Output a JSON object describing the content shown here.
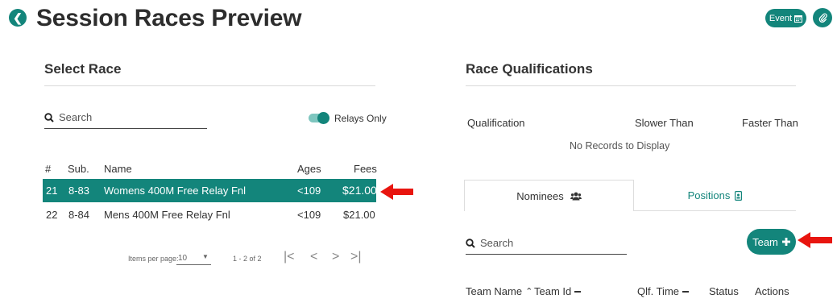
{
  "header": {
    "back_icon": "arrow-left-icon",
    "title": "Session Races Preview",
    "event_label": "Event",
    "event_icon": "calendar-icon",
    "attach_icon": "paperclip-icon",
    "accent_color": "#13857b",
    "pointer_color": "#e8150f"
  },
  "select_race": {
    "title": "Select Race",
    "search_placeholder": "Search",
    "relays_only_label": "Relays Only",
    "relays_only_on": true,
    "columns": [
      "#",
      "Sub.",
      "Name",
      "Ages",
      "Fees"
    ],
    "rows": [
      {
        "num": "21",
        "sub": "8-83",
        "name": "Womens 400M Free Relay Fnl",
        "ages": "<109",
        "fees": "$21.00",
        "selected": true
      },
      {
        "num": "22",
        "sub": "8-84",
        "name": "Mens 400M Free Relay Fnl",
        "ages": "<109",
        "fees": "$21.00",
        "selected": false
      }
    ],
    "paginator": {
      "items_per_page_label": "Items per page:",
      "items_per_page_value": "10",
      "range_label": "1 - 2 of 2"
    }
  },
  "race_qualifications": {
    "title": "Race Qualifications",
    "columns": [
      "Qualification",
      "Slower Than",
      "Faster Than"
    ],
    "empty_message": "No Records to Display"
  },
  "tabs": {
    "nominees_label": "Nominees",
    "nominees_icon": "users-icon",
    "positions_label": "Positions",
    "positions_icon": "id-badge-icon"
  },
  "nominees": {
    "search_placeholder": "Search",
    "team_button_label": "Team",
    "columns": [
      "Team Name",
      "Team Id",
      "Qlf. Time",
      "Status",
      "Actions"
    ]
  }
}
